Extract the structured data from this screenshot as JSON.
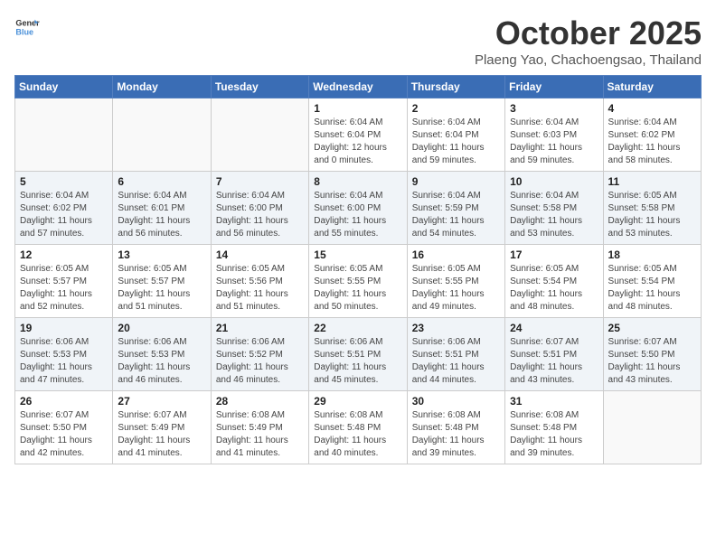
{
  "header": {
    "logo_line1": "General",
    "logo_line2": "Blue",
    "month_title": "October 2025",
    "location": "Plaeng Yao, Chachoengsao, Thailand"
  },
  "weekdays": [
    "Sunday",
    "Monday",
    "Tuesday",
    "Wednesday",
    "Thursday",
    "Friday",
    "Saturday"
  ],
  "weeks": [
    [
      {
        "day": "",
        "info": ""
      },
      {
        "day": "",
        "info": ""
      },
      {
        "day": "",
        "info": ""
      },
      {
        "day": "1",
        "info": "Sunrise: 6:04 AM\nSunset: 6:04 PM\nDaylight: 12 hours\nand 0 minutes."
      },
      {
        "day": "2",
        "info": "Sunrise: 6:04 AM\nSunset: 6:04 PM\nDaylight: 11 hours\nand 59 minutes."
      },
      {
        "day": "3",
        "info": "Sunrise: 6:04 AM\nSunset: 6:03 PM\nDaylight: 11 hours\nand 59 minutes."
      },
      {
        "day": "4",
        "info": "Sunrise: 6:04 AM\nSunset: 6:02 PM\nDaylight: 11 hours\nand 58 minutes."
      }
    ],
    [
      {
        "day": "5",
        "info": "Sunrise: 6:04 AM\nSunset: 6:02 PM\nDaylight: 11 hours\nand 57 minutes."
      },
      {
        "day": "6",
        "info": "Sunrise: 6:04 AM\nSunset: 6:01 PM\nDaylight: 11 hours\nand 56 minutes."
      },
      {
        "day": "7",
        "info": "Sunrise: 6:04 AM\nSunset: 6:00 PM\nDaylight: 11 hours\nand 56 minutes."
      },
      {
        "day": "8",
        "info": "Sunrise: 6:04 AM\nSunset: 6:00 PM\nDaylight: 11 hours\nand 55 minutes."
      },
      {
        "day": "9",
        "info": "Sunrise: 6:04 AM\nSunset: 5:59 PM\nDaylight: 11 hours\nand 54 minutes."
      },
      {
        "day": "10",
        "info": "Sunrise: 6:04 AM\nSunset: 5:58 PM\nDaylight: 11 hours\nand 53 minutes."
      },
      {
        "day": "11",
        "info": "Sunrise: 6:05 AM\nSunset: 5:58 PM\nDaylight: 11 hours\nand 53 minutes."
      }
    ],
    [
      {
        "day": "12",
        "info": "Sunrise: 6:05 AM\nSunset: 5:57 PM\nDaylight: 11 hours\nand 52 minutes."
      },
      {
        "day": "13",
        "info": "Sunrise: 6:05 AM\nSunset: 5:57 PM\nDaylight: 11 hours\nand 51 minutes."
      },
      {
        "day": "14",
        "info": "Sunrise: 6:05 AM\nSunset: 5:56 PM\nDaylight: 11 hours\nand 51 minutes."
      },
      {
        "day": "15",
        "info": "Sunrise: 6:05 AM\nSunset: 5:55 PM\nDaylight: 11 hours\nand 50 minutes."
      },
      {
        "day": "16",
        "info": "Sunrise: 6:05 AM\nSunset: 5:55 PM\nDaylight: 11 hours\nand 49 minutes."
      },
      {
        "day": "17",
        "info": "Sunrise: 6:05 AM\nSunset: 5:54 PM\nDaylight: 11 hours\nand 48 minutes."
      },
      {
        "day": "18",
        "info": "Sunrise: 6:05 AM\nSunset: 5:54 PM\nDaylight: 11 hours\nand 48 minutes."
      }
    ],
    [
      {
        "day": "19",
        "info": "Sunrise: 6:06 AM\nSunset: 5:53 PM\nDaylight: 11 hours\nand 47 minutes."
      },
      {
        "day": "20",
        "info": "Sunrise: 6:06 AM\nSunset: 5:53 PM\nDaylight: 11 hours\nand 46 minutes."
      },
      {
        "day": "21",
        "info": "Sunrise: 6:06 AM\nSunset: 5:52 PM\nDaylight: 11 hours\nand 46 minutes."
      },
      {
        "day": "22",
        "info": "Sunrise: 6:06 AM\nSunset: 5:51 PM\nDaylight: 11 hours\nand 45 minutes."
      },
      {
        "day": "23",
        "info": "Sunrise: 6:06 AM\nSunset: 5:51 PM\nDaylight: 11 hours\nand 44 minutes."
      },
      {
        "day": "24",
        "info": "Sunrise: 6:07 AM\nSunset: 5:51 PM\nDaylight: 11 hours\nand 43 minutes."
      },
      {
        "day": "25",
        "info": "Sunrise: 6:07 AM\nSunset: 5:50 PM\nDaylight: 11 hours\nand 43 minutes."
      }
    ],
    [
      {
        "day": "26",
        "info": "Sunrise: 6:07 AM\nSunset: 5:50 PM\nDaylight: 11 hours\nand 42 minutes."
      },
      {
        "day": "27",
        "info": "Sunrise: 6:07 AM\nSunset: 5:49 PM\nDaylight: 11 hours\nand 41 minutes."
      },
      {
        "day": "28",
        "info": "Sunrise: 6:08 AM\nSunset: 5:49 PM\nDaylight: 11 hours\nand 41 minutes."
      },
      {
        "day": "29",
        "info": "Sunrise: 6:08 AM\nSunset: 5:48 PM\nDaylight: 11 hours\nand 40 minutes."
      },
      {
        "day": "30",
        "info": "Sunrise: 6:08 AM\nSunset: 5:48 PM\nDaylight: 11 hours\nand 39 minutes."
      },
      {
        "day": "31",
        "info": "Sunrise: 6:08 AM\nSunset: 5:48 PM\nDaylight: 11 hours\nand 39 minutes."
      },
      {
        "day": "",
        "info": ""
      }
    ]
  ]
}
